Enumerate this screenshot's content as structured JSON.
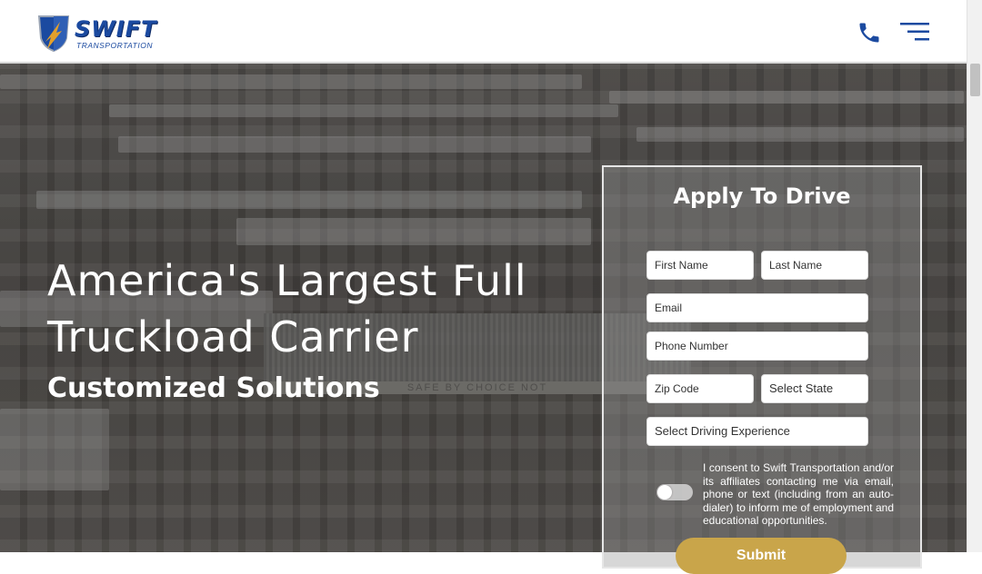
{
  "header": {
    "logo_text": "SWIFT",
    "logo_subtext": "TRANSPORTATION",
    "phone_icon": "phone-icon",
    "menu_icon": "hamburger-menu-icon",
    "brand_color": "#1b4aa0"
  },
  "hero": {
    "title": "America's Largest Full Truckload Carrier",
    "subtitle": "Customized Solutions",
    "canopy_sign": "SAFE BY CHOICE NOT"
  },
  "form": {
    "title": "Apply To Drive",
    "first_name_placeholder": "First Name",
    "last_name_placeholder": "Last Name",
    "email_placeholder": "Email",
    "phone_placeholder": "Phone Number",
    "zip_placeholder": "Zip Code",
    "state_selected": "Select State",
    "experience_selected": "Select Driving Experience",
    "consent_text": "I consent to Swift Transportation and/or its affiliates contacting me via email, phone or text (including from an auto-dialer) to inform me of employment and educational opportunities.",
    "submit_label": "Submit",
    "submit_color": "#c9a54a"
  }
}
